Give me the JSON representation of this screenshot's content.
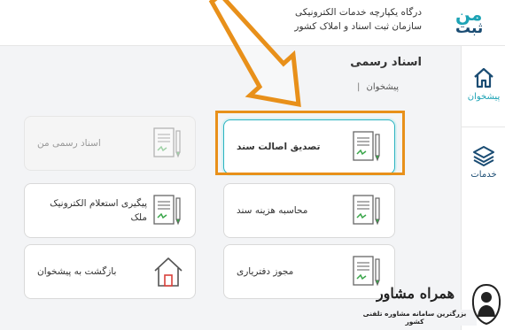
{
  "header": {
    "line1": "درگاه یکپارچه خدمات الکترونیکی",
    "line2": "سازمان ثبت اسناد و املاک کشور",
    "logo_top": "من",
    "logo_bottom": "ثبت"
  },
  "sidebar": {
    "items": [
      {
        "label": "پیشخوان",
        "icon": "home-icon"
      },
      {
        "label": "خدمات",
        "icon": "layers-icon"
      }
    ]
  },
  "main": {
    "title": "اسناد رسمی",
    "breadcrumb": "پیشخوان"
  },
  "cards": [
    {
      "label": "تصدیق اصالت سند",
      "state": "selected",
      "icon": "document-icon"
    },
    {
      "label": "اسناد رسمی من",
      "state": "disabled",
      "icon": "document-icon"
    },
    {
      "label": "محاسبه هزینه سند",
      "state": "normal",
      "icon": "document-icon"
    },
    {
      "label": "پیگیری استعلام الکترونیک ملک",
      "state": "normal",
      "icon": "document-icon"
    },
    {
      "label": "مجوز دفترياری",
      "state": "normal",
      "icon": "document-icon"
    },
    {
      "label": "بازگشت به پیشخوان",
      "state": "normal",
      "icon": "home-outline-icon"
    }
  ],
  "watermark": {
    "title": "همراه مشاور",
    "subtitle": "بزرگترین سامانه مشاوره تلفنی کشور"
  },
  "colors": {
    "accent": "#2bb3c0",
    "brand_dark": "#1a4c73",
    "highlight": "#e8901a"
  }
}
